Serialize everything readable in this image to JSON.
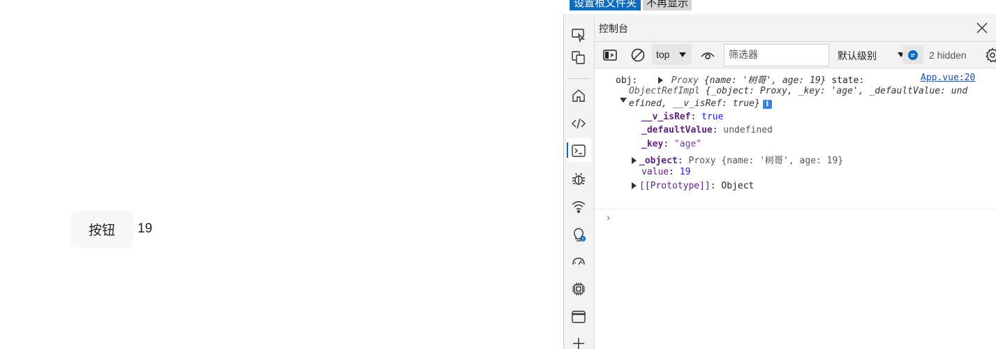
{
  "page": {
    "button_label": "按钮",
    "value": "19"
  },
  "infobar": {
    "primary_label": "设置根文件夹",
    "secondary_label": "不再显示"
  },
  "devtools": {
    "tab_title": "控制台",
    "toolbar": {
      "context": "top",
      "filter_placeholder": "筛选器",
      "levels_label": "默认级别",
      "hidden_count": "2 hidden"
    },
    "log": {
      "source_link": "App.vue:20",
      "obj_label": "obj:",
      "obj_preview_type": "Proxy",
      "obj_preview_body": "{name: '树哥', age: 19}",
      "state_label": "state:",
      "state_type": "ObjectRefImpl",
      "state_preview_line1": "{_object: Proxy, _key: 'age', _defaultValue: und",
      "state_preview_line2": "efined, __v_isRef: true}",
      "props": [
        {
          "key": "__v_isRef",
          "sep": ": ",
          "value": "true"
        },
        {
          "key": "_defaultValue",
          "sep": ": ",
          "value": "undefined"
        },
        {
          "key": "_key",
          "sep": ": ",
          "value": "\"age\""
        },
        {
          "key": "_object",
          "sep": ": ",
          "value": "Proxy {name: '树哥', age: 19}"
        },
        {
          "key": "value",
          "sep": ": ",
          "value": "19"
        },
        {
          "key": "[[Prototype]]",
          "sep": ": ",
          "value": "Object"
        }
      ]
    }
  }
}
